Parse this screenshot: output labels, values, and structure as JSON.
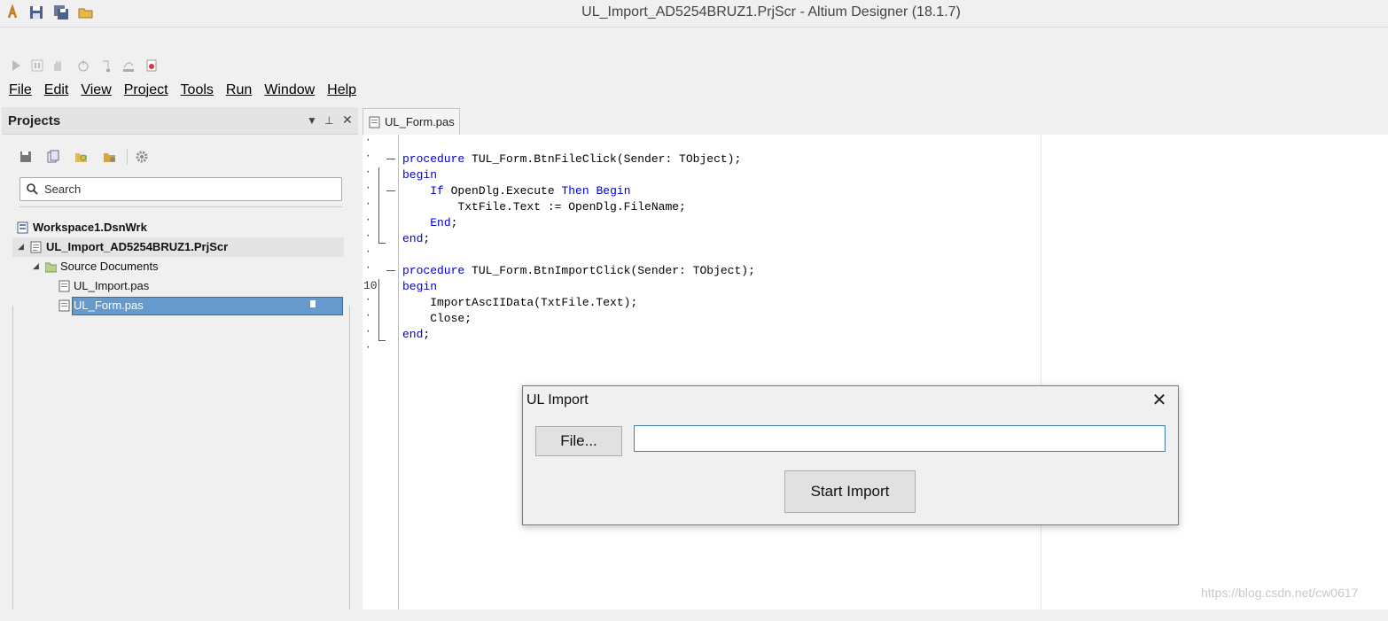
{
  "window": {
    "title": "UL_Import_AD5254BRUZ1.PrjScr - Altium Designer (18.1.7)"
  },
  "menu": [
    "File",
    "Edit",
    "View",
    "Project",
    "Tools",
    "Run",
    "Window",
    "Help"
  ],
  "projects": {
    "title": "Projects",
    "search_placeholder": "Search",
    "tree": [
      {
        "label": "Workspace1.DsnWrk",
        "bold": true
      },
      {
        "label": "UL_Import_AD5254BRUZ1.PrjScr",
        "bold": true
      },
      {
        "label": "Source Documents",
        "bold": false
      },
      {
        "label": "UL_Import.pas",
        "bold": false
      },
      {
        "label": "UL_Form.pas",
        "bold": false,
        "selected": true
      }
    ]
  },
  "editor": {
    "tab": "UL_Form.pas",
    "line_number_label": "10",
    "code": [
      "procedure TUL_Form.BtnFileClick(Sender: TObject);",
      "begin",
      "    If OpenDlg.Execute Then Begin",
      "        TxtFile.Text := OpenDlg.FileName;",
      "    End;",
      "end;",
      "",
      "procedure TUL_Form.BtnImportClick(Sender: TObject);",
      "begin",
      "    ImportAscIIData(TxtFile.Text);",
      "    Close;",
      "end;"
    ]
  },
  "dialog": {
    "title": "UL Import",
    "close_glyph": "✕",
    "file_button": "File...",
    "file_input_value": "",
    "start_button": "Start Import"
  },
  "watermark": "https://blog.csdn.net/cw0617",
  "colors": {
    "keyword": "#0000cc",
    "selection": "#6699cc",
    "accent_border": "#3c7fb1"
  }
}
